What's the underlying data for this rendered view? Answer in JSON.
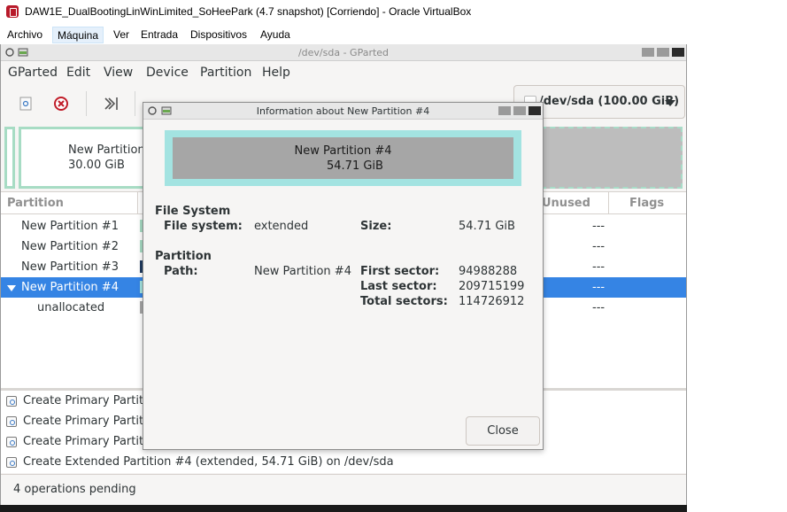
{
  "vbox": {
    "title": "DAW1E_DualBootingLinWinLimited_SoHeePark (4.7 snapshot) [Corriendo] - Oracle VirtualBox",
    "menu": [
      "Archivo",
      "Máquina",
      "Ver",
      "Entrada",
      "Dispositivos",
      "Ayuda"
    ]
  },
  "gparted": {
    "title": "/dev/sda - GParted",
    "menu": [
      "GParted",
      "Edit",
      "View",
      "Device",
      "Partition",
      "Help"
    ],
    "device": "/dev/sda (100.00 GiB)",
    "diskmap": {
      "first_partition_name": "New Partition",
      "first_partition_size": "30.00 GiB"
    },
    "columns": {
      "partition": "Partition",
      "unused": "Unused",
      "flags": "Flags"
    },
    "rows": [
      {
        "name": "New Partition #1",
        "unused": "---",
        "color": "#a7dcc4"
      },
      {
        "name": "New Partition #2",
        "unused": "---",
        "color": "#a7dcc4"
      },
      {
        "name": "New Partition #3",
        "unused": "---",
        "color": "#1f3a5f"
      },
      {
        "name": "New Partition #4",
        "unused": "---",
        "color": "#a3e3e1"
      },
      {
        "name": "unallocated",
        "unused": "---",
        "color": "#a6a6a6"
      }
    ],
    "operations": [
      "Create Primary Partiti",
      "Create Primary Partiti",
      "Create Primary Partiti",
      "Create Extended Partition #4 (extended, 54.71 GiB) on /dev/sda"
    ],
    "status": "4 operations pending"
  },
  "dialog": {
    "title": "Information about New Partition #4",
    "visual_name": "New Partition #4",
    "visual_size": "54.71 GiB",
    "fs_section": "File System",
    "fs_label": "File system:",
    "fs_value": "extended",
    "size_label": "Size:",
    "size_value": "54.71 GiB",
    "part_section": "Partition",
    "path_label": "Path:",
    "path_value": "New Partition #4",
    "first_label": "First sector:",
    "first_value": "94988288",
    "last_label": "Last sector:",
    "last_value": "209715199",
    "total_label": "Total sectors:",
    "total_value": "114726912",
    "close": "Close"
  }
}
